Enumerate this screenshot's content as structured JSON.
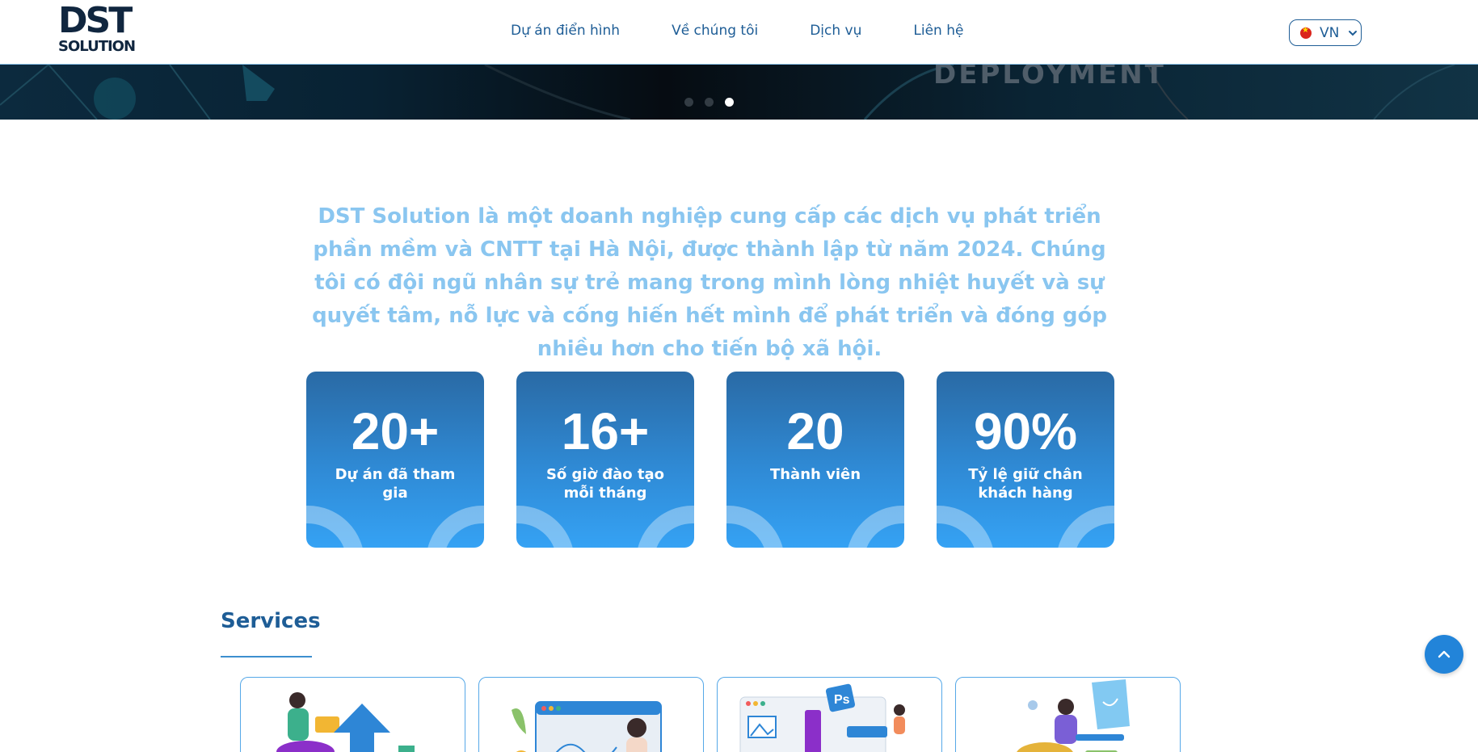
{
  "header": {
    "logo_line1": "DST",
    "logo_line2": "SOLUTION",
    "nav": [
      {
        "label": "Dự án điển hình"
      },
      {
        "label": "Về chúng tôi"
      },
      {
        "label": "Dịch vụ"
      },
      {
        "label": "Liên hệ"
      }
    ],
    "language": {
      "label": "VN",
      "icon": "vietnam-flag-icon"
    }
  },
  "hero": {
    "text": "DEPLOYMENT",
    "slides_total": 3,
    "active_slide": 3
  },
  "intro": {
    "text": "DST Solution là một doanh nghiệp cung cấp các dịch vụ phát triển phần mềm và CNTT tại Hà Nội, được thành lập từ năm 2024. Chúng tôi có đội ngũ nhân sự trẻ mang trong mình lòng nhiệt huyết và sự quyết tâm, nỗ lực và cống hiến hết mình để phát triển và đóng góp nhiều hơn cho tiến bộ xã hội."
  },
  "stats": [
    {
      "value": "20+",
      "label": "Dự án đã tham gia"
    },
    {
      "value": "16+",
      "label": "Số giờ đào tạo mỗi tháng"
    },
    {
      "value": "20",
      "label": "Thành viên"
    },
    {
      "value": "90%",
      "label": "Tỷ lệ giữ chân khách hàng"
    }
  ],
  "services": {
    "title": "Services",
    "cards": [
      {
        "icon": "team-collaboration-illustration"
      },
      {
        "icon": "analytics-dashboard-illustration"
      },
      {
        "icon": "design-tools-illustration"
      },
      {
        "icon": "ai-robot-illustration"
      }
    ]
  },
  "colors": {
    "primary": "#1e5d96",
    "intro_text": "#8ac6f0",
    "stat_gradient_top": "#2a6aa5",
    "stat_gradient_bottom": "#35a2f4",
    "back_to_top": "#2284d9"
  },
  "back_to_top": {
    "icon": "chevron-up-icon"
  }
}
